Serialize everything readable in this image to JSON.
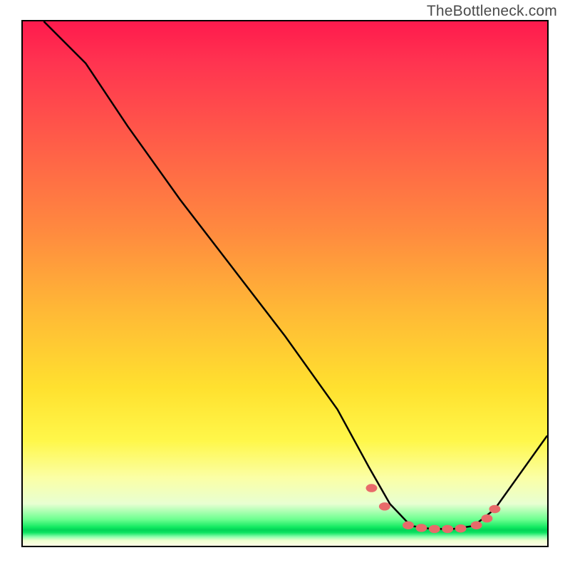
{
  "watermark": "TheBottleneck.com",
  "chart_data": {
    "type": "line",
    "title": "",
    "xlabel": "",
    "ylabel": "",
    "xlim": [
      0,
      100
    ],
    "ylim": [
      0,
      100
    ],
    "series": [
      {
        "name": "bottleneck-curve",
        "x": [
          4,
          12,
          16,
          20,
          30,
          40,
          50,
          60,
          66,
          70,
          74,
          78,
          82,
          86,
          90,
          100
        ],
        "y": [
          100,
          92,
          86,
          80,
          66,
          53,
          40,
          26,
          15,
          8,
          3.8,
          3.2,
          3.2,
          3.8,
          7,
          21
        ],
        "color": "#000000"
      }
    ],
    "markers": {
      "name": "highlight-dots",
      "x": [
        66.5,
        69,
        73.5,
        76,
        78.5,
        81,
        83.5,
        86.5,
        88.5,
        90
      ],
      "y": [
        11,
        7.5,
        3.9,
        3.4,
        3.2,
        3.2,
        3.3,
        3.9,
        5.2,
        7
      ],
      "color": "#e86a6a",
      "radius": 8
    },
    "background_gradient": {
      "stops": [
        {
          "pos": 0.0,
          "color": "#ff1a4d"
        },
        {
          "pos": 0.4,
          "color": "#ff8a3f"
        },
        {
          "pos": 0.7,
          "color": "#ffe12f"
        },
        {
          "pos": 0.92,
          "color": "#e8ffd2"
        },
        {
          "pos": 0.97,
          "color": "#02d357"
        },
        {
          "pos": 1.0,
          "color": "#fdffe8"
        }
      ]
    }
  }
}
